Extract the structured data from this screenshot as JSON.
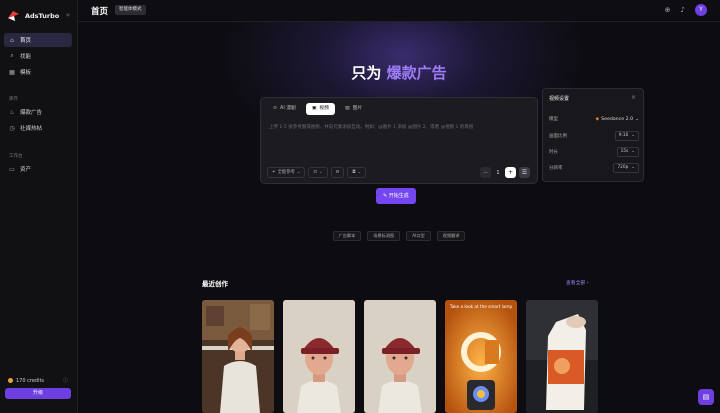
{
  "app": {
    "name": "AdsTurbo"
  },
  "sidebar": {
    "collapse_glyph": "«",
    "main_items": [
      {
        "label": "首页",
        "icon": "home-icon",
        "active": true
      },
      {
        "label": "找能",
        "icon": "search-icon",
        "active": false
      },
      {
        "label": "模板",
        "icon": "grid-icon",
        "active": false
      }
    ],
    "section_label": "库存",
    "library_items": [
      {
        "label": "爆款广告",
        "icon": "fire-icon"
      },
      {
        "label": "社媒热帖",
        "icon": "clock-icon"
      }
    ],
    "workspace_label": "工作台",
    "workspace_items": [
      {
        "label": "资产",
        "icon": "folder-icon"
      }
    ],
    "credits": "170 credits",
    "upgrade_label": "升级"
  },
  "header": {
    "title": "首页",
    "mode_chip": "智能体模式",
    "avatar_initial": "Y"
  },
  "hero": {
    "prefix": "只为 ",
    "highlight": "爆款广告"
  },
  "composer": {
    "tabs": [
      {
        "label": "AI 漫剧",
        "icon": "clapper-icon",
        "active": false
      },
      {
        "label": "视频",
        "icon": "video-icon",
        "active": true
      },
      {
        "label": "图片",
        "icon": "image-icon",
        "active": false
      }
    ],
    "placeholder": "上传 1-5 张参考图或视频，并向元素添加互动。例如：@图片 1 添加 @图片 2，或者 @视频 1 的风格",
    "tools": [
      {
        "label": "全能参考",
        "icon": "sparkle-icon"
      },
      {
        "label": "",
        "icon": "frame-icon"
      },
      {
        "label": "",
        "icon": "split-icon"
      },
      {
        "label": "",
        "icon": "camera-icon"
      }
    ],
    "quantity": "1",
    "minus": "−",
    "plus": "+"
  },
  "generate_label": "开始生成",
  "suggestions": [
    "广告脚本",
    "场景标测图",
    "AI口型",
    "视频翻译"
  ],
  "settings": {
    "title": "视频设置",
    "close": "×",
    "rows": [
      {
        "label": "模型",
        "value": "Seedance 2.0"
      },
      {
        "label": "画面比例",
        "value": "9:16"
      },
      {
        "label": "时长",
        "value": "15s"
      },
      {
        "label": "分辨率",
        "value": "720p"
      }
    ]
  },
  "recent": {
    "title": "最近创作",
    "view_all": "查看全部",
    "card4_caption": "Take a look at the smart lamp"
  },
  "colors": {
    "accent": "#7446f0",
    "highlight": "#9d7cf7"
  }
}
